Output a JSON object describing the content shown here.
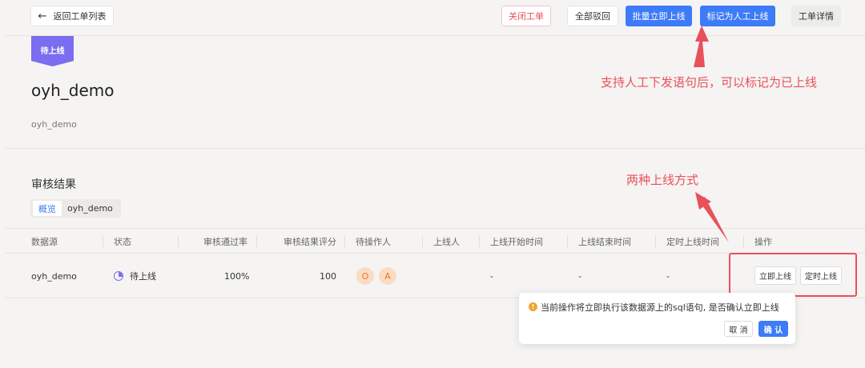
{
  "header": {
    "back_label": "返回工单列表",
    "close_label": "关闭工单",
    "reject_all_label": "全部驳回",
    "batch_online_label": "批量立即上线",
    "mark_manual_label": "标记为人工上线",
    "detail_label": "工单详情"
  },
  "status_badge": "待上线",
  "page_title": "oyh_demo",
  "page_subtitle": "oyh_demo",
  "section_title": "审核结果",
  "tabs": [
    {
      "label": "概览",
      "active": true
    },
    {
      "label": "oyh_demo",
      "active": false
    }
  ],
  "table": {
    "columns": [
      "数据源",
      "状态",
      "审核通过率",
      "审核结果评分",
      "待操作人",
      "上线人",
      "上线开始时间",
      "上线结束时间",
      "定时上线时间",
      "操作"
    ],
    "rows": [
      {
        "datasource": "oyh_demo",
        "status": "待上线",
        "pass_rate": "100%",
        "score": "100",
        "operators": [
          "O",
          "A"
        ],
        "online_user": "",
        "start_time": "-",
        "end_time": "-",
        "scheduled_time": "-",
        "actions": [
          "立即上线",
          "定时上线"
        ]
      }
    ]
  },
  "popconfirm": {
    "message": "当前操作将立即执行该数据源上的sql语句, 是否确认立即上线",
    "cancel_label": "取 消",
    "ok_label": "确 认"
  },
  "annotations": {
    "note1": "支持人工下发语句后，可以标记为已上线",
    "note2": "两种上线方式"
  },
  "colors": {
    "primary": "#3d7bf7",
    "badge": "#7a6df0",
    "annotation": "#e8505b",
    "warning": "#f0a430"
  }
}
